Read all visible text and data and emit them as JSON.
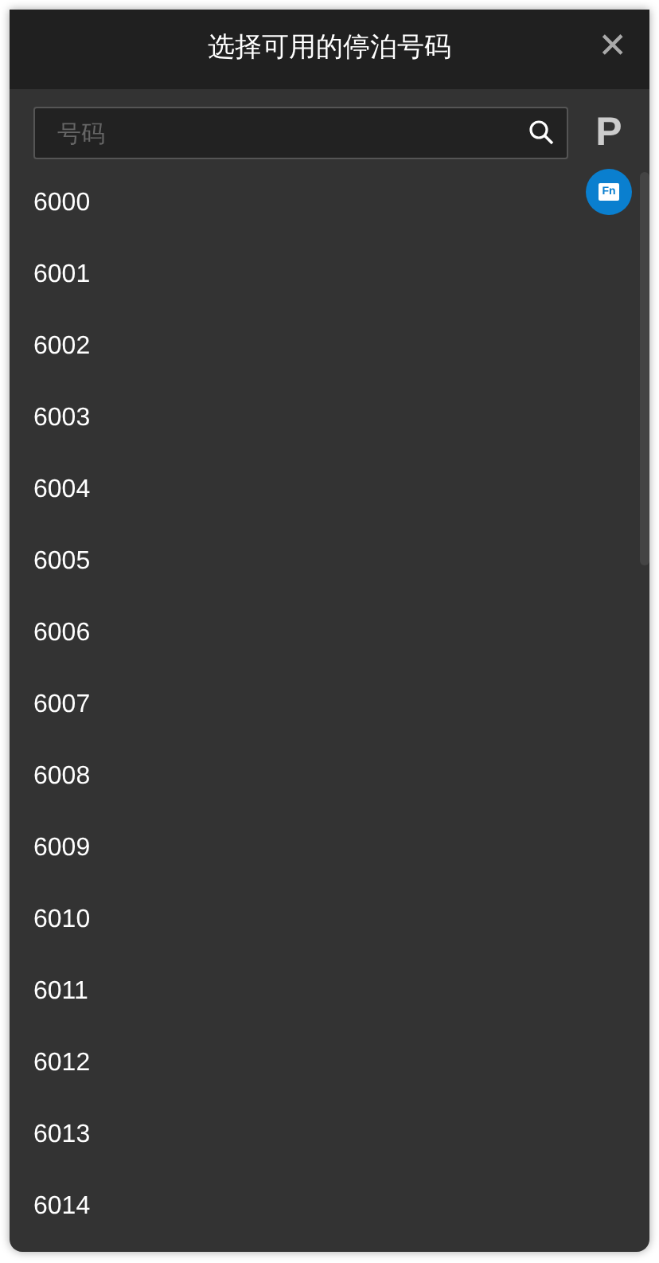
{
  "dialog": {
    "title": "选择可用的停泊号码",
    "close": "✕"
  },
  "search": {
    "placeholder": "号码"
  },
  "index": {
    "letter": "P",
    "badge": "Fn"
  },
  "numbers": [
    "6000",
    "6001",
    "6002",
    "6003",
    "6004",
    "6005",
    "6006",
    "6007",
    "6008",
    "6009",
    "6010",
    "6011",
    "6012",
    "6013",
    "6014"
  ]
}
